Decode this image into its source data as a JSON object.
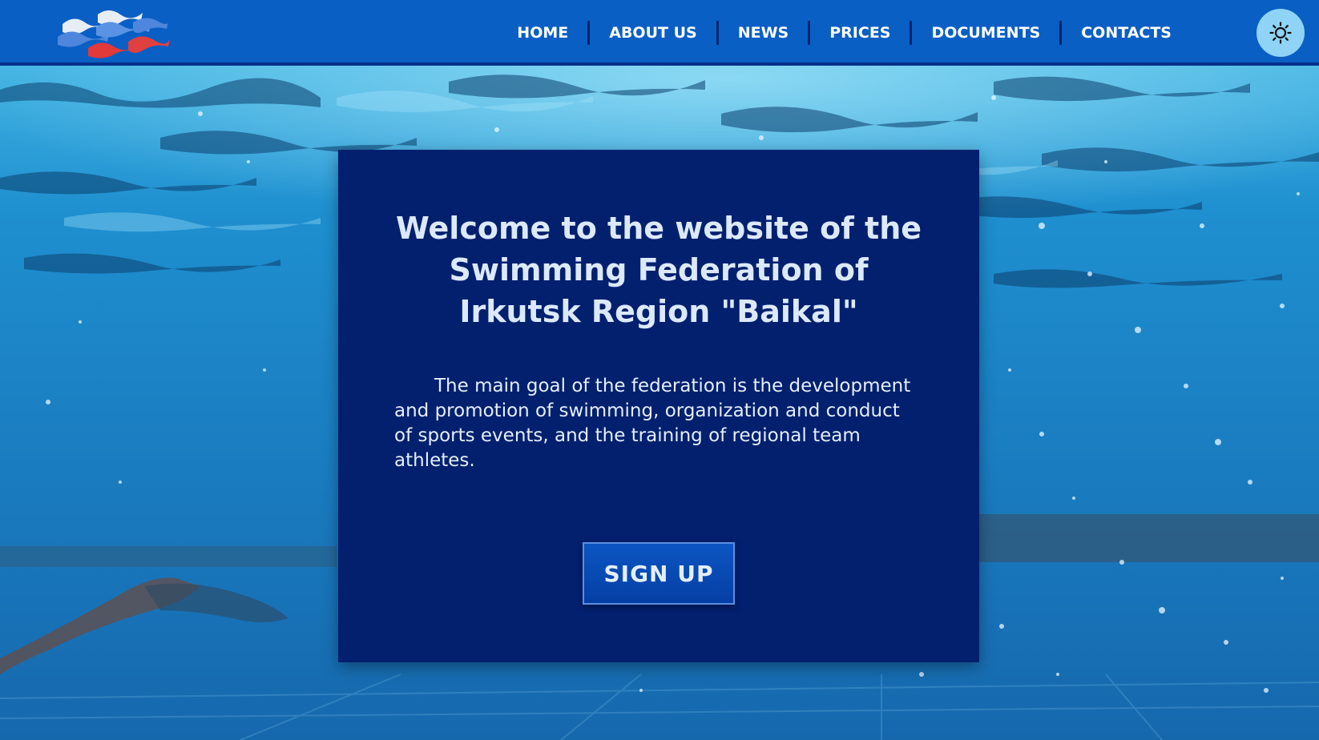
{
  "header": {
    "logo_alt": "Flag waves logo",
    "nav": [
      {
        "label": "HOME"
      },
      {
        "label": "ABOUT US"
      },
      {
        "label": "NEWS"
      },
      {
        "label": "PRICES"
      },
      {
        "label": "DOCUMENTS"
      },
      {
        "label": "CONTACTS"
      }
    ],
    "theme_toggle_icon": "sun-icon"
  },
  "hero": {
    "title": "Welcome to the website of the Swimming Federation of Irkutsk Region \"Baikal\"",
    "description": "The main goal of the federation is the development and promotion of swimming, organization and conduct of sports events, and the training of regional team athletes.",
    "cta_label": "SIGN UP"
  },
  "colors": {
    "header_bg": "#0a5fc4",
    "card_bg": "#03206f",
    "button_bg": "#0b55c2",
    "toggle_bg": "#8fd3f7",
    "water": "#1a7fc0"
  }
}
